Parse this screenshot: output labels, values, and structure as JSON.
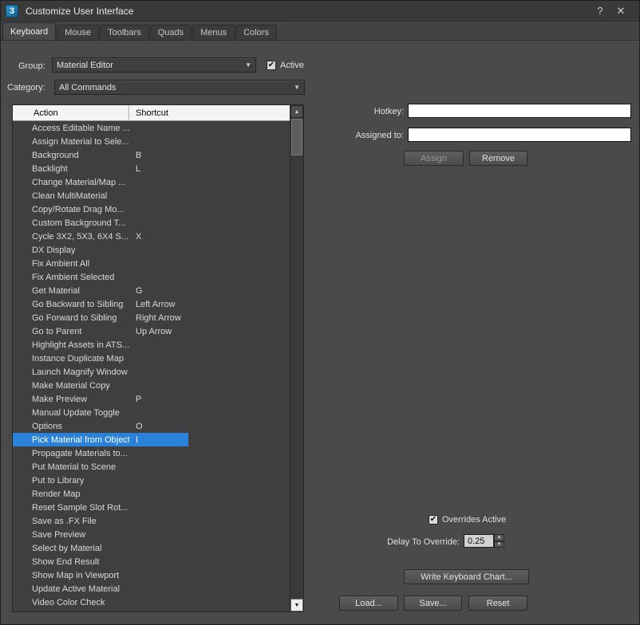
{
  "window": {
    "icon_text": "3",
    "title": "Customize User Interface",
    "help_label": "?",
    "close_label": "✕"
  },
  "tabs": [
    {
      "label": "Keyboard",
      "active": true
    },
    {
      "label": "Mouse",
      "active": false
    },
    {
      "label": "Toolbars",
      "active": false
    },
    {
      "label": "Quads",
      "active": false
    },
    {
      "label": "Menus",
      "active": false
    },
    {
      "label": "Colors",
      "active": false
    }
  ],
  "group": {
    "label": "Group:",
    "value": "Material Editor"
  },
  "group_active": {
    "label": "Active",
    "checked": true
  },
  "category": {
    "label": "Category:",
    "value": "All Commands"
  },
  "table": {
    "columns": [
      "Action",
      "Shortcut"
    ],
    "rows": [
      {
        "action": "Access Editable Name ...",
        "shortcut": "",
        "selected": false
      },
      {
        "action": "Assign Material to Sele...",
        "shortcut": "",
        "selected": false
      },
      {
        "action": "Background",
        "shortcut": "B",
        "selected": false
      },
      {
        "action": "Backlight",
        "shortcut": "L",
        "selected": false
      },
      {
        "action": "Change Material/Map ...",
        "shortcut": "",
        "selected": false
      },
      {
        "action": "Clean  MultiMaterial",
        "shortcut": "",
        "selected": false
      },
      {
        "action": "Copy/Rotate Drag Mo...",
        "shortcut": "",
        "selected": false
      },
      {
        "action": "Custom Background T...",
        "shortcut": "",
        "selected": false
      },
      {
        "action": "Cycle 3X2, 5X3, 6X4 S...",
        "shortcut": "X",
        "selected": false
      },
      {
        "action": "DX Display",
        "shortcut": "",
        "selected": false
      },
      {
        "action": "Fix Ambient All",
        "shortcut": "",
        "selected": false
      },
      {
        "action": "Fix Ambient Selected",
        "shortcut": "",
        "selected": false
      },
      {
        "action": "Get Material",
        "shortcut": "G",
        "selected": false
      },
      {
        "action": "Go Backward to Sibling",
        "shortcut": "Left Arrow",
        "selected": false
      },
      {
        "action": "Go Forward to Sibling",
        "shortcut": "Right Arrow",
        "selected": false
      },
      {
        "action": "Go to Parent",
        "shortcut": "Up Arrow",
        "selected": false
      },
      {
        "action": "Highlight Assets in ATS...",
        "shortcut": "",
        "selected": false
      },
      {
        "action": "Instance Duplicate Map",
        "shortcut": "",
        "selected": false
      },
      {
        "action": "Launch Magnify Window",
        "shortcut": "",
        "selected": false
      },
      {
        "action": "Make Material Copy",
        "shortcut": "",
        "selected": false
      },
      {
        "action": "Make Preview",
        "shortcut": "P",
        "selected": false
      },
      {
        "action": "Manual Update Toggle",
        "shortcut": "",
        "selected": false
      },
      {
        "action": "Options",
        "shortcut": "O",
        "selected": false
      },
      {
        "action": "Pick Material from Object",
        "shortcut": "I",
        "selected": true
      },
      {
        "action": "Propagate Materials to...",
        "shortcut": "",
        "selected": false
      },
      {
        "action": "Put Material to Scene",
        "shortcut": "",
        "selected": false
      },
      {
        "action": "Put to Library",
        "shortcut": "",
        "selected": false
      },
      {
        "action": "Render Map",
        "shortcut": "",
        "selected": false
      },
      {
        "action": "Reset Sample Slot Rot...",
        "shortcut": "",
        "selected": false
      },
      {
        "action": "Save as .FX File",
        "shortcut": "",
        "selected": false
      },
      {
        "action": "Save Preview",
        "shortcut": "",
        "selected": false
      },
      {
        "action": "Select by Material",
        "shortcut": "",
        "selected": false
      },
      {
        "action": "Show End Result",
        "shortcut": "",
        "selected": false
      },
      {
        "action": "Show Map in Viewport",
        "shortcut": "",
        "selected": false
      },
      {
        "action": "Update Active Material",
        "shortcut": "",
        "selected": false
      },
      {
        "action": "Video Color Check",
        "shortcut": "",
        "selected": false
      }
    ]
  },
  "hotkey": {
    "label": "Hotkey:",
    "value": ""
  },
  "assigned_to": {
    "label": "Assigned to:",
    "value": ""
  },
  "actions": {
    "assign": "Assign",
    "remove": "Remove"
  },
  "overrides": {
    "label": "Overrides Active",
    "checked": true
  },
  "delay": {
    "label": "Delay To Override:",
    "value": "0.25"
  },
  "footer": {
    "write_chart": "Write Keyboard Chart...",
    "load": "Load...",
    "save": "Save...",
    "reset": "Reset"
  },
  "colors": {
    "selection": "#2a82da",
    "accent_icon": "#2c9bd6"
  }
}
